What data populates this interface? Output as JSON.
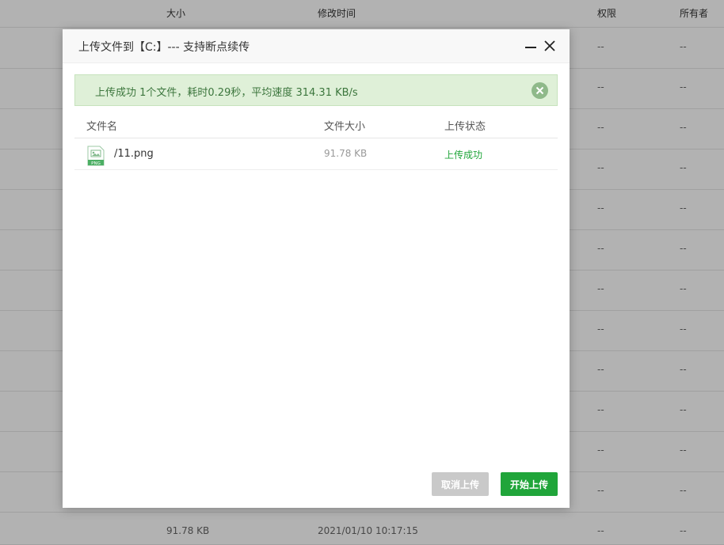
{
  "background": {
    "header": {
      "size": "大小",
      "modified": "修改时间",
      "permission": "权限",
      "owner": "所有者"
    },
    "placeholder": "--",
    "last_row": {
      "size": "91.78 KB",
      "modified": "2021/01/10 10:17:15"
    }
  },
  "dialog": {
    "title": "上传文件到【C:】--- 支持断点续传",
    "alert": "上传成功 1个文件，耗时0.29秒，平均速度 314.31 KB/s",
    "columns": {
      "name": "文件名",
      "size": "文件大小",
      "status": "上传状态"
    },
    "files": [
      {
        "name": "/11.png",
        "size": "91.78 KB",
        "status": "上传成功",
        "icon_label": "PNG"
      }
    ],
    "buttons": {
      "cancel": "取消上传",
      "start": "开始上传"
    }
  },
  "colors": {
    "accent": "#20a53a",
    "alert_bg": "#dff0d8",
    "alert_text": "#3c763d",
    "cancel_bg": "#c9c9c9"
  }
}
